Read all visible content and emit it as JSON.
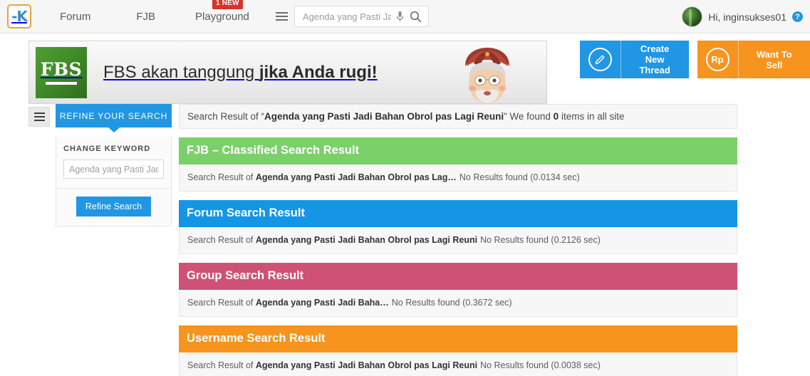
{
  "topnav": {
    "logo_alt": "kaskus-logo",
    "links": [
      {
        "label": "Forum",
        "name": "nav-forum"
      },
      {
        "label": "FJB",
        "name": "nav-fjb"
      },
      {
        "label": "Playground",
        "name": "nav-playground"
      }
    ],
    "playground_badge": "1 NEW",
    "search": {
      "value": "",
      "placeholder": "Agenda yang Pasti Jadi Bahan Obrol pas Lagi Reuni",
      "mic_icon": "microphone-icon",
      "search_icon": "search-icon",
      "menu_icon": "hamburger-menu-icon"
    },
    "user": {
      "greeting": "Hi, inginsukses01",
      "help_label": "?",
      "avatar_alt": "user-avatar"
    }
  },
  "banner": {
    "brand": "FBS",
    "text_regular": "FBS akan tanggung ",
    "text_bold": "jika Anda rugi!",
    "character_alt": "cartoon-guru-character"
  },
  "cta": {
    "create_thread": {
      "label": "Create New\nThread",
      "label_line1": "Create New",
      "label_line2": "Thread",
      "icon": "pencil-icon",
      "color": "#2196e3"
    },
    "want_to_sell": {
      "label": "Want To Sell",
      "icon": "rupiah-icon",
      "icon_text": "Rp",
      "color": "#f6941d"
    }
  },
  "sidebar": {
    "toggle_icon": "sidebar-toggle-icon",
    "refine_header": "REFINE YOUR SEARCH",
    "change_keyword_label": "CHANGE KEYWORD",
    "keyword_input": {
      "value": "",
      "placeholder": "Agenda yang Pasti Jadi Bahan Obrol pas Lagi Reuni"
    },
    "refine_button": "Refine Search"
  },
  "summary": {
    "prefix": "Search Result of “",
    "query": "Agenda yang Pasti Jadi Bahan Obrol pas Lagi Reuni",
    "middle": "” We found ",
    "count": "0",
    "suffix": " items in all site"
  },
  "sections": [
    {
      "title": "FJB – Classified Search Result",
      "color": "#7bd069",
      "class": "sec-green",
      "name": "fjb-classified-search-result",
      "row_prefix": "Search Result of ",
      "row_query": "Agenda yang Pasti Jadi Bahan Obrol pas Lag…",
      "row_suffix": "No Results found (0.0134 sec)"
    },
    {
      "title": "Forum Search Result",
      "color": "#1595e6",
      "class": "sec-blue",
      "name": "forum-search-result",
      "row_prefix": "Search Result of ",
      "row_query": "Agenda yang Pasti Jadi Bahan Obrol pas Lagi Reuni",
      "row_suffix": "No Results found (0.2126 sec)"
    },
    {
      "title": "Group Search Result",
      "color": "#cf5276",
      "class": "sec-pink",
      "name": "group-search-result",
      "row_prefix": "Search Result of ",
      "row_query": "Agenda yang Pasti Jadi Baha…",
      "row_suffix": "No Results found (0.3672 sec)"
    },
    {
      "title": "Username Search Result",
      "color": "#f6941d",
      "class": "sec-orange",
      "name": "username-search-result",
      "row_prefix": "Search Result of ",
      "row_query": "Agenda yang Pasti Jadi Bahan Obrol pas Lagi Reuni",
      "row_suffix": "No Results found (0.0038 sec)"
    }
  ]
}
